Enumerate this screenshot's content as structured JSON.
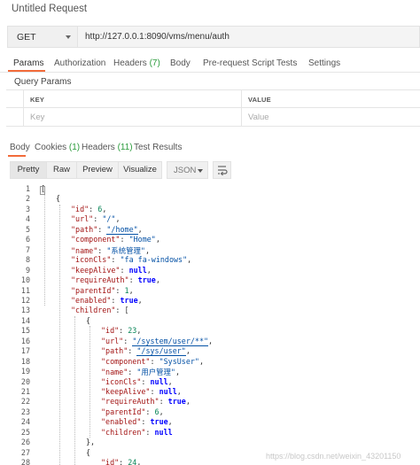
{
  "window": {
    "title": "Untitled Request"
  },
  "request": {
    "method": "GET",
    "url": "http://127.0.0.1:8090/vms/menu/auth"
  },
  "request_tabs": [
    {
      "label": "Params",
      "count": ""
    },
    {
      "label": "Authorization",
      "count": ""
    },
    {
      "label": "Headers ",
      "count": "(7)"
    },
    {
      "label": "Body",
      "count": ""
    },
    {
      "label": "Pre-request Script",
      "count": ""
    },
    {
      "label": "Tests",
      "count": ""
    },
    {
      "label": "Settings",
      "count": ""
    }
  ],
  "query_params": {
    "title": "Query Params",
    "key_header": "KEY",
    "value_header": "VALUE",
    "key_placeholder": "Key",
    "value_placeholder": "Value"
  },
  "response_tabs": [
    {
      "label": "Body",
      "count": ""
    },
    {
      "label": "Cookies ",
      "count": "(1)"
    },
    {
      "label": "Headers ",
      "count": "(11)"
    },
    {
      "label": "Test Results",
      "count": ""
    }
  ],
  "view_modes": [
    "Pretty",
    "Raw",
    "Preview",
    "Visualize"
  ],
  "format": "JSON",
  "accent_color": "#f26b3a",
  "count_color": "#2b9b3c",
  "code_lines": [
    {
      "n": "1",
      "indent": 0,
      "tokens": [
        [
          "p",
          "["
        ]
      ]
    },
    {
      "n": "2",
      "indent": 1,
      "tokens": [
        [
          "p",
          "{"
        ]
      ]
    },
    {
      "n": "3",
      "indent": 2,
      "tokens": [
        [
          "k",
          "\"id\""
        ],
        [
          "p",
          ": "
        ],
        [
          "n",
          "6"
        ],
        [
          "p",
          ","
        ]
      ]
    },
    {
      "n": "4",
      "indent": 2,
      "tokens": [
        [
          "k",
          "\"url\""
        ],
        [
          "p",
          ": "
        ],
        [
          "s",
          "\"/\""
        ],
        [
          "p",
          ","
        ]
      ]
    },
    {
      "n": "5",
      "indent": 2,
      "tokens": [
        [
          "k",
          "\"path\""
        ],
        [
          "p",
          ": "
        ],
        [
          "su",
          "\"/home\""
        ],
        [
          "p",
          ","
        ]
      ]
    },
    {
      "n": "6",
      "indent": 2,
      "tokens": [
        [
          "k",
          "\"component\""
        ],
        [
          "p",
          ": "
        ],
        [
          "s",
          "\"Home\""
        ],
        [
          "p",
          ","
        ]
      ]
    },
    {
      "n": "7",
      "indent": 2,
      "tokens": [
        [
          "k",
          "\"name\""
        ],
        [
          "p",
          ": "
        ],
        [
          "s",
          "\"系统管理\""
        ],
        [
          "p",
          ","
        ]
      ]
    },
    {
      "n": "8",
      "indent": 2,
      "tokens": [
        [
          "k",
          "\"iconCls\""
        ],
        [
          "p",
          ": "
        ],
        [
          "s",
          "\"fa fa-windows\""
        ],
        [
          "p",
          ","
        ]
      ]
    },
    {
      "n": "9",
      "indent": 2,
      "tokens": [
        [
          "k",
          "\"keepAlive\""
        ],
        [
          "p",
          ": "
        ],
        [
          "v",
          "null"
        ],
        [
          "p",
          ","
        ]
      ]
    },
    {
      "n": "10",
      "indent": 2,
      "tokens": [
        [
          "k",
          "\"requireAuth\""
        ],
        [
          "p",
          ": "
        ],
        [
          "v",
          "true"
        ],
        [
          "p",
          ","
        ]
      ]
    },
    {
      "n": "11",
      "indent": 2,
      "tokens": [
        [
          "k",
          "\"parentId\""
        ],
        [
          "p",
          ": "
        ],
        [
          "n",
          "1"
        ],
        [
          "p",
          ","
        ]
      ]
    },
    {
      "n": "12",
      "indent": 2,
      "tokens": [
        [
          "k",
          "\"enabled\""
        ],
        [
          "p",
          ": "
        ],
        [
          "v",
          "true"
        ],
        [
          "p",
          ","
        ]
      ]
    },
    {
      "n": "13",
      "indent": 2,
      "tokens": [
        [
          "k",
          "\"children\""
        ],
        [
          "p",
          ": ["
        ]
      ]
    },
    {
      "n": "14",
      "indent": 3,
      "tokens": [
        [
          "p",
          "{"
        ]
      ]
    },
    {
      "n": "15",
      "indent": 4,
      "tokens": [
        [
          "k",
          "\"id\""
        ],
        [
          "p",
          ": "
        ],
        [
          "n",
          "23"
        ],
        [
          "p",
          ","
        ]
      ]
    },
    {
      "n": "16",
      "indent": 4,
      "tokens": [
        [
          "k",
          "\"url\""
        ],
        [
          "p",
          ": "
        ],
        [
          "su",
          "\"/system/user/**\""
        ],
        [
          "p",
          ","
        ]
      ]
    },
    {
      "n": "17",
      "indent": 4,
      "tokens": [
        [
          "k",
          "\"path\""
        ],
        [
          "p",
          ": "
        ],
        [
          "su",
          "\"/sys/user\""
        ],
        [
          "p",
          ","
        ]
      ]
    },
    {
      "n": "18",
      "indent": 4,
      "tokens": [
        [
          "k",
          "\"component\""
        ],
        [
          "p",
          ": "
        ],
        [
          "s",
          "\"SysUser\""
        ],
        [
          "p",
          ","
        ]
      ]
    },
    {
      "n": "19",
      "indent": 4,
      "tokens": [
        [
          "k",
          "\"name\""
        ],
        [
          "p",
          ": "
        ],
        [
          "s",
          "\"用户管理\""
        ],
        [
          "p",
          ","
        ]
      ]
    },
    {
      "n": "20",
      "indent": 4,
      "tokens": [
        [
          "k",
          "\"iconCls\""
        ],
        [
          "p",
          ": "
        ],
        [
          "v",
          "null"
        ],
        [
          "p",
          ","
        ]
      ]
    },
    {
      "n": "21",
      "indent": 4,
      "tokens": [
        [
          "k",
          "\"keepAlive\""
        ],
        [
          "p",
          ": "
        ],
        [
          "v",
          "null"
        ],
        [
          "p",
          ","
        ]
      ]
    },
    {
      "n": "22",
      "indent": 4,
      "tokens": [
        [
          "k",
          "\"requireAuth\""
        ],
        [
          "p",
          ": "
        ],
        [
          "v",
          "true"
        ],
        [
          "p",
          ","
        ]
      ]
    },
    {
      "n": "23",
      "indent": 4,
      "tokens": [
        [
          "k",
          "\"parentId\""
        ],
        [
          "p",
          ": "
        ],
        [
          "n",
          "6"
        ],
        [
          "p",
          ","
        ]
      ]
    },
    {
      "n": "24",
      "indent": 4,
      "tokens": [
        [
          "k",
          "\"enabled\""
        ],
        [
          "p",
          ": "
        ],
        [
          "v",
          "true"
        ],
        [
          "p",
          ","
        ]
      ]
    },
    {
      "n": "25",
      "indent": 4,
      "tokens": [
        [
          "k",
          "\"children\""
        ],
        [
          "p",
          ": "
        ],
        [
          "v",
          "null"
        ]
      ]
    },
    {
      "n": "26",
      "indent": 3,
      "tokens": [
        [
          "p",
          "},"
        ]
      ]
    },
    {
      "n": "27",
      "indent": 3,
      "tokens": [
        [
          "p",
          "{"
        ]
      ]
    },
    {
      "n": "28",
      "indent": 4,
      "tokens": [
        [
          "k",
          "\"id\""
        ],
        [
          "p",
          ": "
        ],
        [
          "n",
          "24"
        ],
        [
          "p",
          ","
        ]
      ]
    }
  ],
  "watermark": "https://blog.csdn.net/weixin_43201150"
}
